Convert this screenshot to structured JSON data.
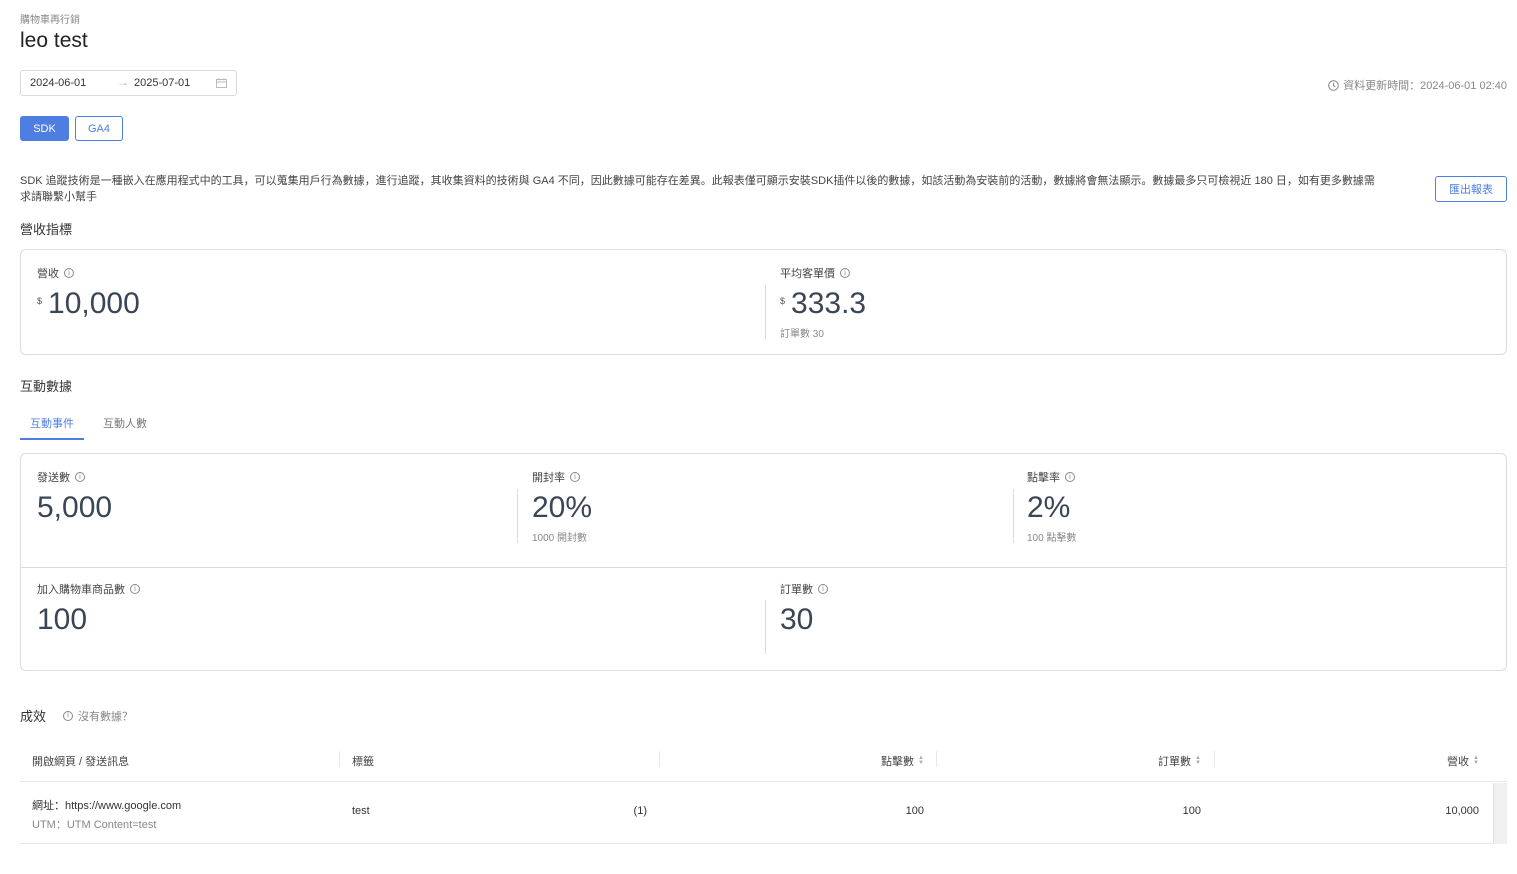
{
  "breadcrumb": "購物車再行銷",
  "title": "leo test",
  "date_range": {
    "start": "2024-06-01",
    "end": "2025-07-01",
    "separator": "→"
  },
  "update_time": "資料更新時間：2024-06-01 02:40",
  "source_tabs": {
    "sdk": "SDK",
    "ga4": "GA4"
  },
  "description": "SDK 追蹤技術是一種嵌入在應用程式中的工具，可以蒐集用戶行為數據，進行追蹤，其收集資料的技術與 GA4 不同，因此數據可能存在差異。此報表僅可顯示安裝SDK插件以後的數據，如該活動為安裝前的活動，數據將會無法顯示。數據最多只可檢視近 180 日，如有更多數據需求請聯繫小幫手",
  "export_label": "匯出報表",
  "revenue_section": {
    "title": "營收指標",
    "revenue": {
      "label": "營收",
      "currency": "$",
      "value": "10,000"
    },
    "aov": {
      "label": "平均客單價",
      "currency": "$",
      "value": "333.3",
      "sub": "訂單數 30"
    }
  },
  "engagement_section": {
    "title": "互動數據",
    "tabs": [
      "互動事件",
      "互動人數"
    ],
    "sent": {
      "label": "發送數",
      "value": "5,000"
    },
    "open_rate": {
      "label": "開封率",
      "value": "20%",
      "sub": "1000 開封數"
    },
    "click_rate": {
      "label": "點擊率",
      "value": "2%",
      "sub": "100 點擊數"
    },
    "add_to_cart": {
      "label": "加入購物車商品數",
      "value": "100"
    },
    "orders": {
      "label": "訂單數",
      "value": "30"
    }
  },
  "performance": {
    "title": "成效",
    "no_data": "沒有數據？",
    "columns": [
      "開啟網頁 / 發送訊息",
      "標籤",
      "點擊數",
      "訂單數",
      "營收"
    ],
    "rows": [
      {
        "url": "網址：https://www.google.com",
        "utm": "UTM：UTM Content=test",
        "tag": "test",
        "tag_count": "(1)",
        "clicks": "100",
        "orders": "100",
        "revenue": "10,000"
      }
    ]
  }
}
